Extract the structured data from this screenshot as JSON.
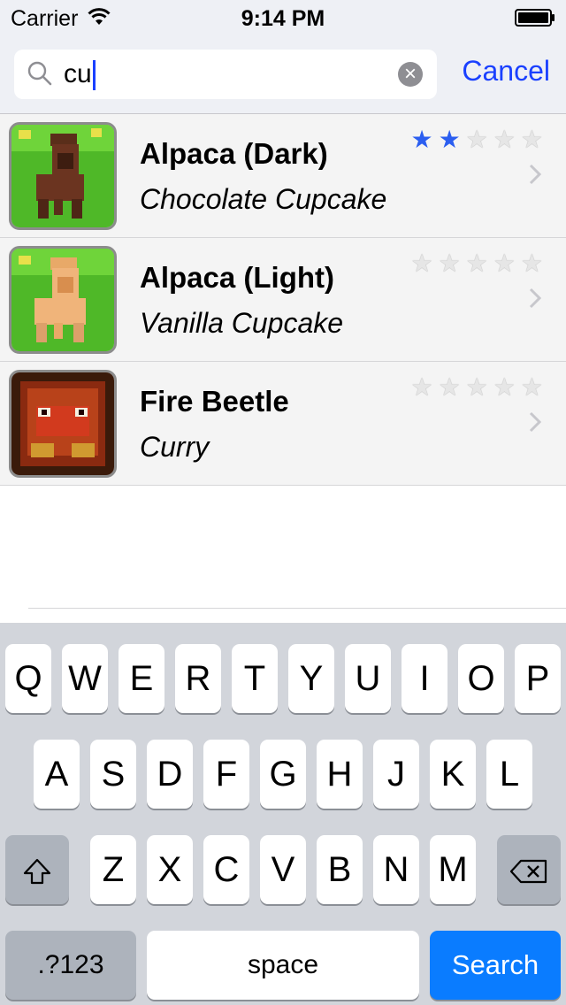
{
  "status_bar": {
    "carrier": "Carrier",
    "time": "9:14 PM"
  },
  "search": {
    "query": "cu",
    "cancel_label": "Cancel"
  },
  "results": [
    {
      "title": "Alpaca (Dark)",
      "subtitle": "Chocolate Cupcake",
      "rating": 2,
      "max_rating": 5
    },
    {
      "title": "Alpaca (Light)",
      "subtitle": "Vanilla Cupcake",
      "rating": 0,
      "max_rating": 5
    },
    {
      "title": "Fire Beetle",
      "subtitle": "Curry",
      "rating": 0,
      "max_rating": 5
    }
  ],
  "keyboard": {
    "row1": [
      "Q",
      "W",
      "E",
      "R",
      "T",
      "Y",
      "U",
      "I",
      "O",
      "P"
    ],
    "row2": [
      "A",
      "S",
      "D",
      "F",
      "G",
      "H",
      "J",
      "K",
      "L"
    ],
    "row3": [
      "Z",
      "X",
      "C",
      "V",
      "B",
      "N",
      "M"
    ],
    "numbers_label": ".?123",
    "space_label": "space",
    "search_label": "Search"
  },
  "colors": {
    "accent": "#1a40ff",
    "search_key": "#0a7cff",
    "star_on": "#2b5ef0"
  }
}
